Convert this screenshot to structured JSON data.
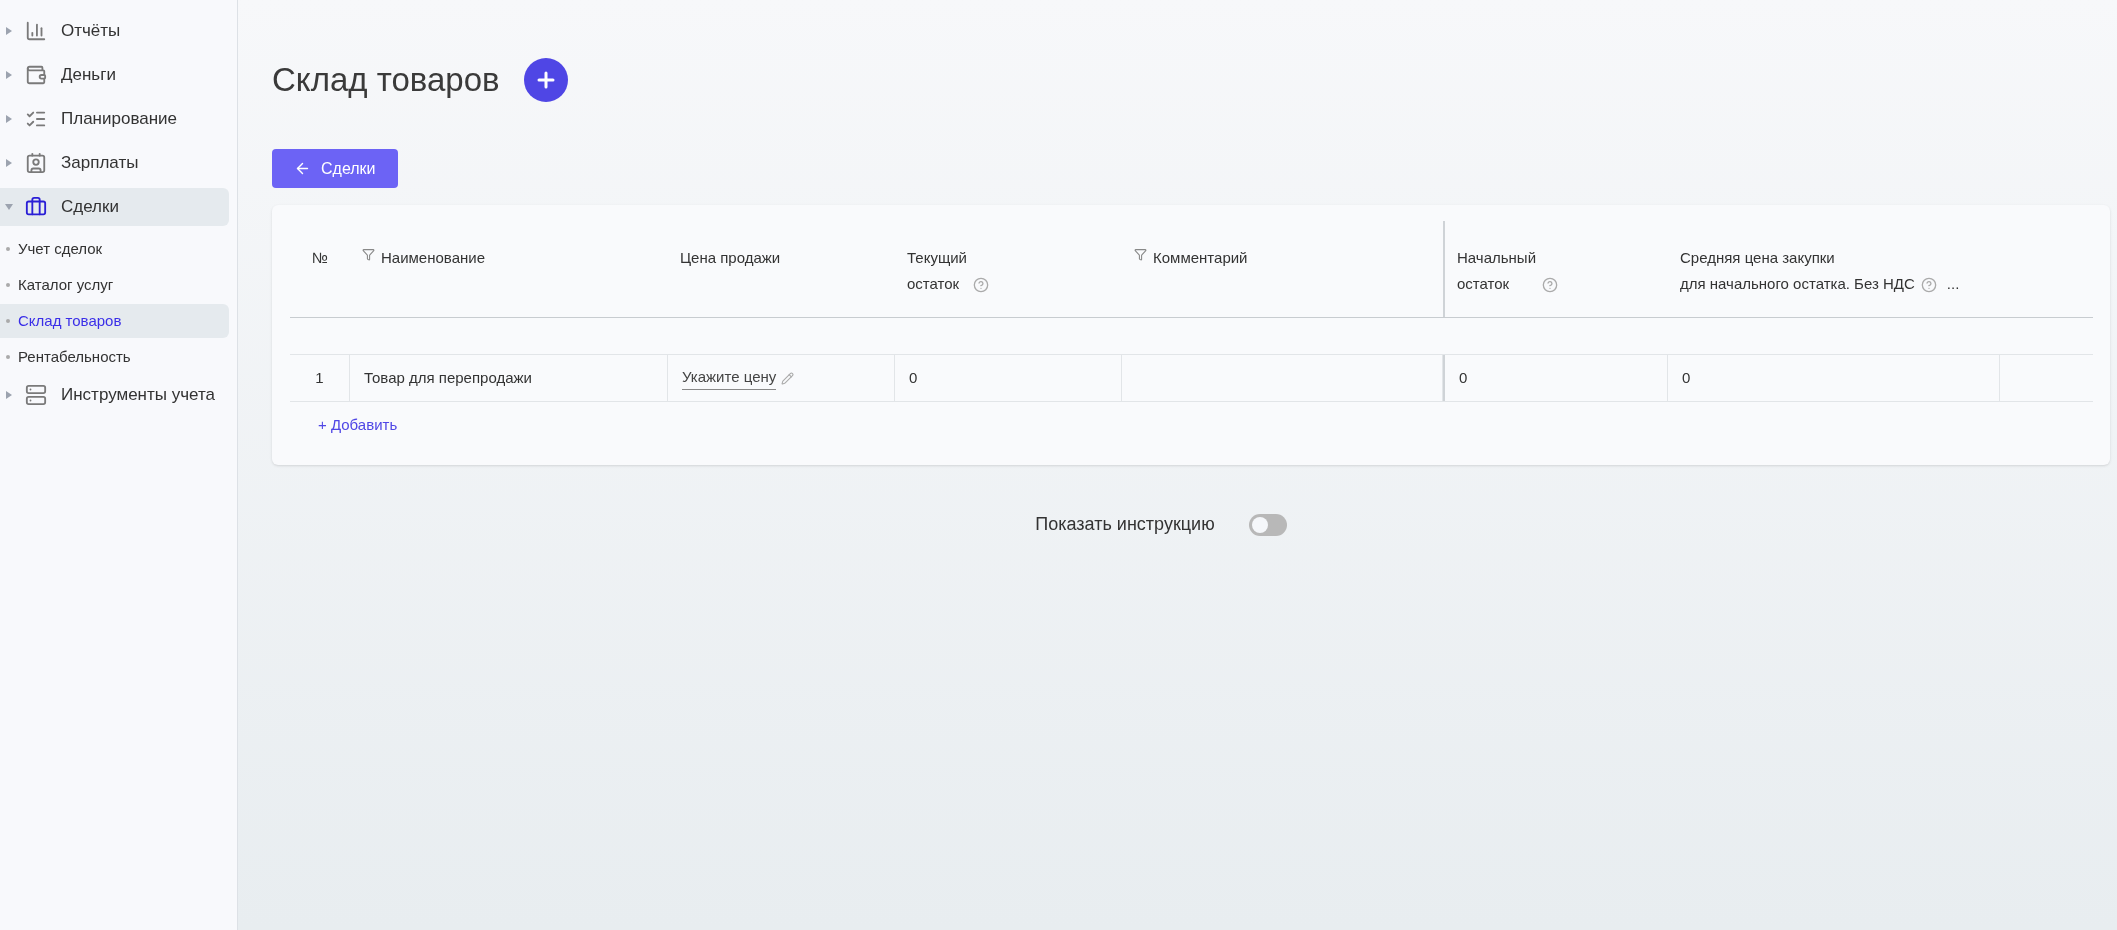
{
  "sidebar": {
    "items": [
      {
        "label": "Отчёты",
        "expanded": false,
        "selected": false
      },
      {
        "label": "Деньги",
        "expanded": false,
        "selected": false
      },
      {
        "label": "Планирование",
        "expanded": false,
        "selected": false
      },
      {
        "label": "Зарплаты",
        "expanded": false,
        "selected": false
      },
      {
        "label": "Сделки",
        "expanded": true,
        "selected": true,
        "children": [
          {
            "label": "Учет сделок",
            "selected": false
          },
          {
            "label": "Каталог услуг",
            "selected": false
          },
          {
            "label": "Склад товаров",
            "selected": true
          },
          {
            "label": "Рентабельность",
            "selected": false
          }
        ]
      },
      {
        "label": "Инструменты учета",
        "expanded": false,
        "selected": false
      }
    ]
  },
  "page": {
    "title": "Склад товаров",
    "back_button": "Сделки"
  },
  "table": {
    "columns": [
      {
        "label": "№",
        "filter": false,
        "help": false
      },
      {
        "label": "Наименование",
        "filter": true,
        "help": false
      },
      {
        "label": "Цена продажи",
        "filter": false,
        "help": false
      },
      {
        "label": "Текущий\nостаток",
        "filter": false,
        "help": true
      },
      {
        "label": "Комментарий",
        "filter": true,
        "help": false
      },
      {
        "label": "Начальный\nостаток",
        "filter": false,
        "help": true
      },
      {
        "label": "Средняя цена закупки\nдля начального остатка. Без НДС",
        "filter": false,
        "help": true,
        "more": "..."
      }
    ],
    "rows": [
      {
        "cells": [
          {
            "kind": "number",
            "text": "1"
          },
          {
            "kind": "text",
            "text": "Товар для перепродажи"
          },
          {
            "kind": "edit",
            "text": "Укажите цену"
          },
          {
            "kind": "text",
            "text": "0"
          },
          {
            "kind": "empty"
          },
          {
            "kind": "text",
            "text": "0"
          },
          {
            "kind": "text",
            "text": "0"
          }
        ]
      }
    ],
    "add_link": "+ Добавить"
  },
  "instruction_toggle": {
    "label": "Показать инструкцию",
    "on": false
  }
}
